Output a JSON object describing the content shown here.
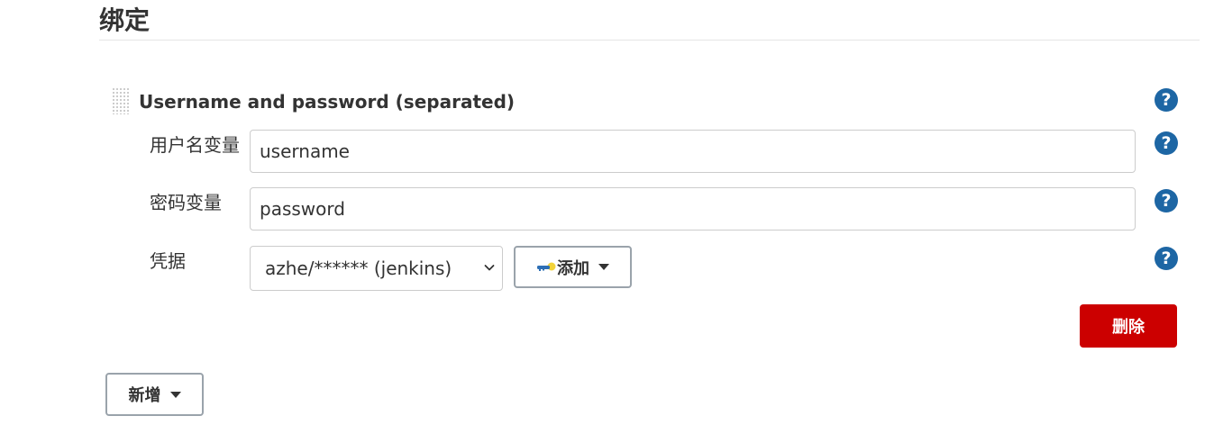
{
  "section": {
    "title": "绑定"
  },
  "binding": {
    "title": "Username and password (separated)",
    "fields": {
      "username": {
        "label": "用户名变量",
        "value": "username"
      },
      "password": {
        "label": "密码变量",
        "value": "password"
      },
      "credentials": {
        "label": "凭据",
        "selected": "azhe/****** (jenkins)",
        "add_label": "添加"
      }
    },
    "delete_label": "删除",
    "help_glyph": "?"
  },
  "footer": {
    "new_label": "新增"
  },
  "colors": {
    "help": "#1d66a4",
    "danger": "#cc0000",
    "border": "#cccccc",
    "button_border": "#9aa3ab"
  },
  "icons": {
    "help": "question-circle-icon",
    "key": "key-icon",
    "chevron": "chevron-down-icon",
    "caret": "caret-down-icon",
    "drag": "drag-handle-icon"
  }
}
